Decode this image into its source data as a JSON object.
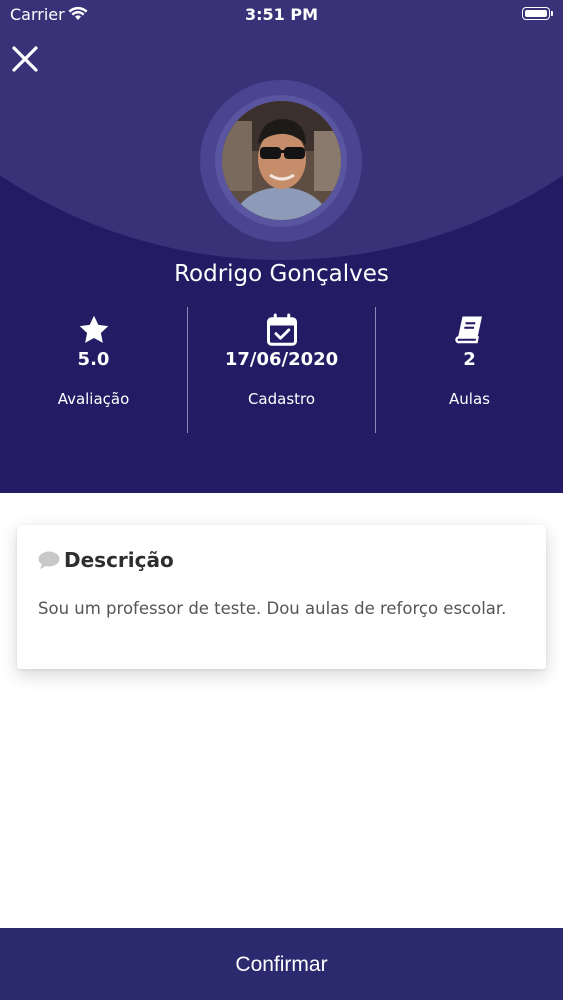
{
  "status_bar": {
    "carrier": "Carrier",
    "time": "3:51 PM"
  },
  "profile": {
    "name": "Rodrigo Gonçalves",
    "stats": [
      {
        "icon": "star-icon",
        "value": "5.0",
        "label": "Avaliação"
      },
      {
        "icon": "calendar-check-icon",
        "value": "17/06/2020",
        "label": "Cadastro"
      },
      {
        "icon": "book-icon",
        "value": "2",
        "label": "Aulas"
      }
    ]
  },
  "description": {
    "title": "Descrição",
    "text": "Sou um professor de teste. Dou aulas de reforço escolar."
  },
  "actions": {
    "confirm_label": "Confirmar"
  },
  "colors": {
    "header": "#231b63",
    "arc": "#3a3278",
    "button": "#2b2a6e"
  }
}
